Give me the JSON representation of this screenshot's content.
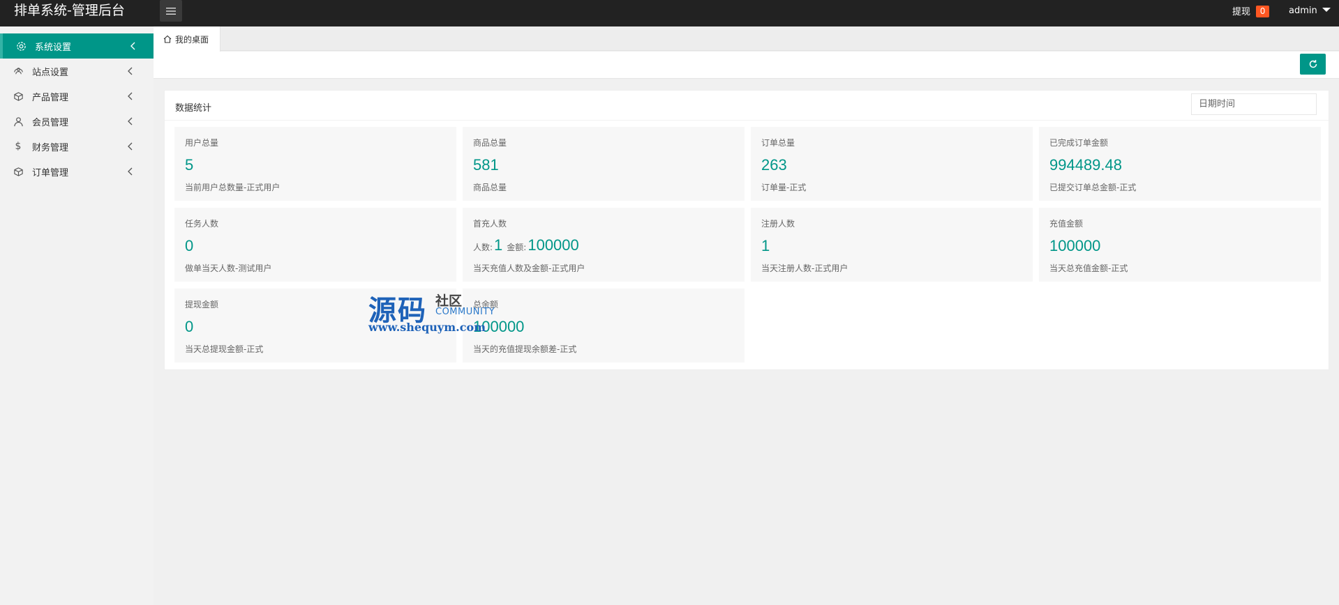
{
  "header": {
    "title": "排单系统-管理后台",
    "withdraw_label": "提现",
    "withdraw_count": "0",
    "user": "admin"
  },
  "sidebar": {
    "items": [
      {
        "label": "系统设置",
        "icon": "gear-icon",
        "active": true
      },
      {
        "label": "站点设置",
        "icon": "site-icon"
      },
      {
        "label": "产品管理",
        "icon": "box-icon"
      },
      {
        "label": "会员管理",
        "icon": "user-icon"
      },
      {
        "label": "财务管理",
        "icon": "dollar-icon"
      },
      {
        "label": "订单管理",
        "icon": "order-icon"
      }
    ]
  },
  "tabs": [
    {
      "label": "我的桌面",
      "icon": "home-icon"
    }
  ],
  "stats_card": {
    "title": "数据统计",
    "date_placeholder": "日期时间"
  },
  "stats": [
    {
      "label": "用户总量",
      "value": "5",
      "desc": "当前用户总数量-正式用户"
    },
    {
      "label": "商品总量",
      "value": "581",
      "desc": "商品总量"
    },
    {
      "label": "订单总量",
      "value": "263",
      "desc": "订单量-正式"
    },
    {
      "label": "已完成订单金额",
      "value": "994489.48",
      "desc": "已提交订单总金额-正式"
    },
    {
      "label": "任务人数",
      "value": "0",
      "desc": "做单当天人数-测试用户"
    },
    {
      "label": "首充人数",
      "count_key": "人数:",
      "count": "1",
      "amount_key": "金额:",
      "amount": "100000",
      "desc": "当天充值人数及金额-正式用户"
    },
    {
      "label": "注册人数",
      "value": "1",
      "desc": "当天注册人数-正式用户"
    },
    {
      "label": "充值金额",
      "value": "100000",
      "desc": "当天总充值金额-正式"
    },
    {
      "label": "提现金额",
      "value": "0",
      "desc": "当天总提现金额-正式"
    },
    {
      "label": "总余额",
      "value": "100000",
      "desc": "当天的充值提现余额差-正式"
    }
  ],
  "watermark": {
    "big": "源码",
    "small": "社区",
    "en": "COMMUNITY",
    "url": "www.shequym.com"
  },
  "colors": {
    "accent": "#009688",
    "header_bg": "#222222",
    "badge": "#ff5722"
  }
}
